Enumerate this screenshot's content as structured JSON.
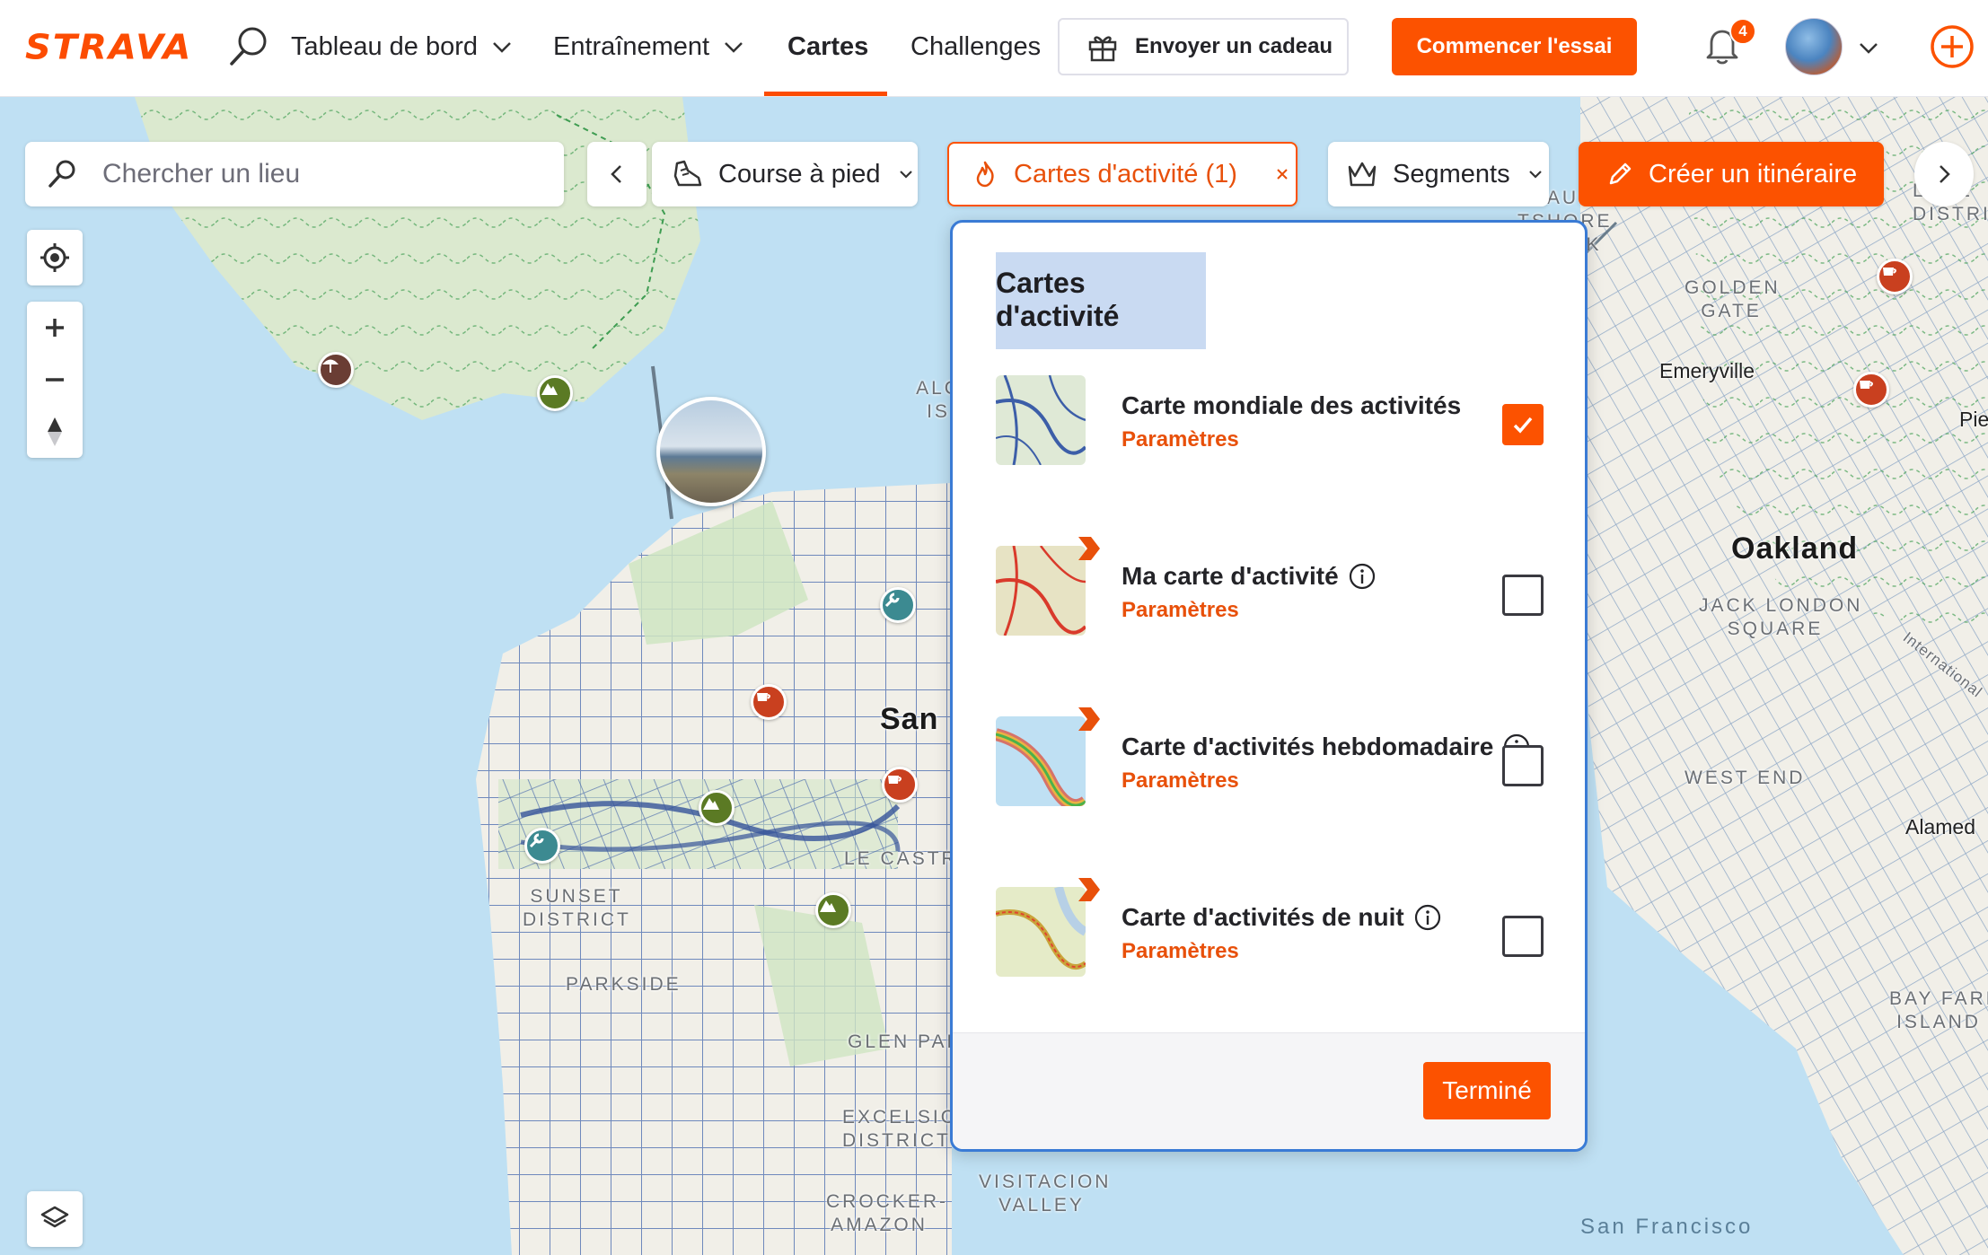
{
  "brand": {
    "logo_text": "STRAVA",
    "accent": "#fc5200"
  },
  "nav": {
    "items": [
      {
        "label": "Tableau de bord",
        "has_menu": true
      },
      {
        "label": "Entraînement",
        "has_menu": true
      },
      {
        "label": "Cartes",
        "active": true
      },
      {
        "label": "Challenges"
      }
    ],
    "gift_label": "Envoyer un cadeau",
    "trial_label": "Commencer l'essai",
    "notification_count": "4",
    "icons": [
      "search-icon",
      "chevron-down-icon",
      "gift-icon",
      "bell-icon",
      "avatar",
      "plus-circle-icon"
    ]
  },
  "toolbar": {
    "search_placeholder": "Chercher un lieu",
    "sport_label": "Course à pied",
    "heatmaps_label": "Cartes d'activité (1)",
    "segments_label": "Segments",
    "create_route_label": "Créer un itinéraire"
  },
  "panel": {
    "title": "Cartes d'activité",
    "layers": [
      {
        "name": "Carte mondiale des activités",
        "settings": "Paramètres",
        "checked": true,
        "info": false,
        "subscriber": false
      },
      {
        "name": "Ma carte d'activité",
        "settings": "Paramètres",
        "checked": false,
        "info": true,
        "subscriber": true
      },
      {
        "name": "Carte d'activités hebdomadaire",
        "settings": "Paramètres",
        "checked": false,
        "info": true,
        "subscriber": true
      },
      {
        "name": "Carte d'activités de nuit",
        "settings": "Paramètres",
        "checked": false,
        "info": true,
        "subscriber": true
      }
    ],
    "done_label": "Terminé"
  },
  "map": {
    "labels": {
      "alcatraz": "ALC\nIS",
      "san": "San",
      "oakland": "Oakland",
      "emeryville": "Emeryville",
      "sunset": "SUNSET\nDISTRICT",
      "parkside": "PARKSIDE",
      "castro": "LE CASTRO",
      "glen_park": "GLEN PAR",
      "excelsior": "EXCELSIOR\nDISTRICT",
      "crocker": "CROCKER-\nAMAZON",
      "visitacion": "VISITACION\nVALLEY",
      "golden_gate": "GOLDEN\nGATE",
      "jack_london": "JACK LONDON\nSQUARE",
      "west_end": "WEST END",
      "alameda": "Alamed",
      "bay_farm": "BAY FARM\nISLAND",
      "sf_bay": "San Francisco",
      "shore_park": "CLAUSORE\nTSHORE\nE PARK",
      "claremont": "LARE\nDISTRICT",
      "piedmont": "Pie",
      "international": "International"
    },
    "colors": {
      "water": "#bfe0f3",
      "land": "#f3f1ea",
      "park": "#d6e8c8",
      "heat": "#3c5ea8",
      "trail": "#3f9d52"
    }
  }
}
